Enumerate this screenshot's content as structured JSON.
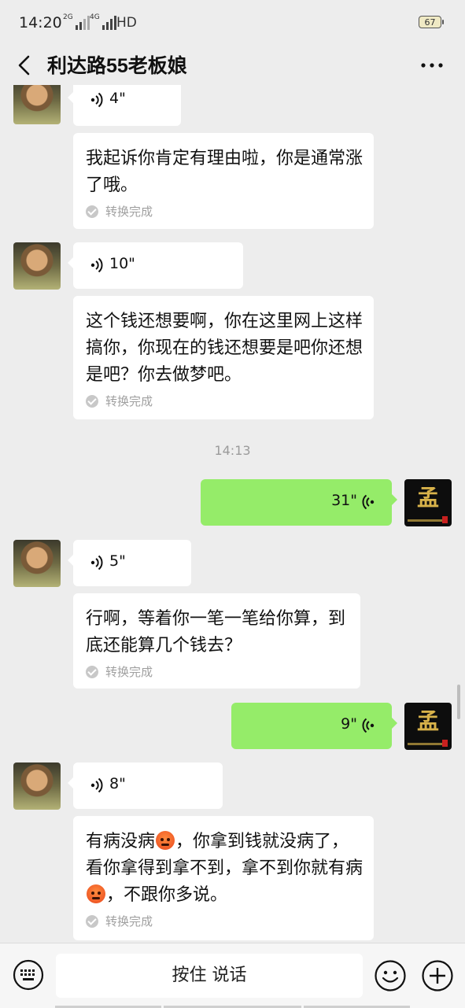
{
  "status_bar": {
    "time": "14:20",
    "net1": "2G",
    "net2": "4G",
    "hd": "HD",
    "battery": "67"
  },
  "nav": {
    "title": "利达路55老板娘"
  },
  "messages": {
    "m1": {
      "duration": "4\"",
      "text": "我起诉你肯定有理由啦，你是通常涨了哦。",
      "status": "转换完成"
    },
    "m2": {
      "duration": "10\"",
      "text": "这个钱还想要啊，你在这里网上这样搞你，你现在的钱还想要是吧你还想是吧？你去做梦吧。",
      "status": "转换完成"
    },
    "timestamp": "14:13",
    "m3": {
      "duration": "31\""
    },
    "m4": {
      "duration": "5\"",
      "text": "行啊，等着你一笔一笔给你算，到底还能算几个钱去？",
      "status": "转换完成"
    },
    "m5": {
      "duration": "9\""
    },
    "m6": {
      "duration": "8\"",
      "text_part1": "有病没病",
      "text_part2": "，你拿到钱就没病了，看你拿得到拿不到，拿不到你就有病",
      "text_part3": "，不跟你多说。",
      "status": "转换完成"
    }
  },
  "avatar_right_glyph": "孟",
  "input": {
    "talk_label": "按住 说话"
  },
  "colors": {
    "sent_bubble": "#95ec69",
    "background": "#ededed"
  }
}
